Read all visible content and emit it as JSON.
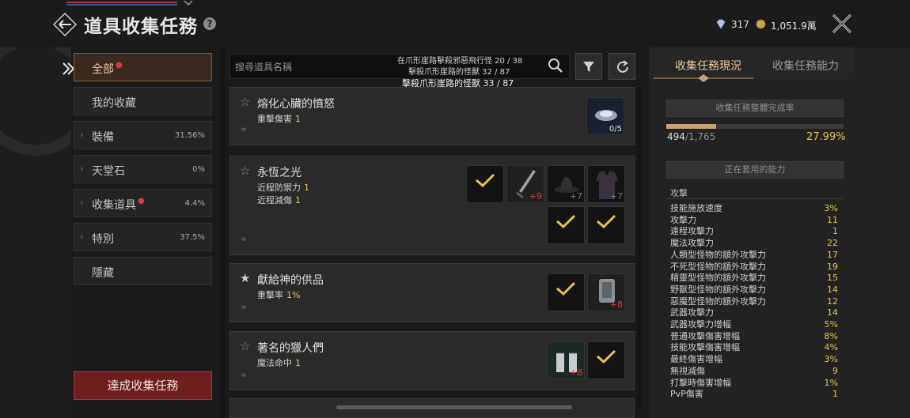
{
  "header": {
    "title": "道具收集任務",
    "help": "?",
    "gem_count": "317",
    "coin_count": "1,051.9萬"
  },
  "sidebar": {
    "categories": [
      {
        "label": "全部",
        "pct": ""
      },
      {
        "label": "我的收藏",
        "pct": ""
      },
      {
        "label": "裝備",
        "pct": "31.56%"
      },
      {
        "label": "天堂石",
        "pct": "0%"
      },
      {
        "label": "收集道具",
        "pct": "4.4%"
      },
      {
        "label": "特別",
        "pct": "37.5%"
      },
      {
        "label": "隱藏",
        "pct": ""
      }
    ],
    "achieve_button": "達成收集任務"
  },
  "search": {
    "placeholder": "搜尋道具名稱",
    "notes": [
      "在爪形崖路擊殺邪惡飛行怪 20 / 38",
      "擊殺爪形崖路的怪獸 32 / 87",
      "擊殺爪形崖路的怪獸 33 / 87"
    ]
  },
  "quests": [
    {
      "title": "熔化心臟的憤怒",
      "stats": [
        {
          "name": "重擊傷害",
          "value": "1"
        }
      ],
      "count": "0/5"
    },
    {
      "title": "永恆之光",
      "stats": [
        {
          "name": "近程防禦力",
          "value": "1"
        },
        {
          "name": "近程減傷",
          "value": "1"
        }
      ],
      "plus": [
        "+9",
        "+7",
        "+7"
      ]
    },
    {
      "title": "獻給神的供品",
      "stats": [
        {
          "name": "重擊率",
          "value": "1%"
        }
      ],
      "plus": [
        "+8"
      ]
    },
    {
      "title": "著名的獵人們",
      "stats": [
        {
          "name": "魔法命中",
          "value": "1"
        }
      ],
      "plus": [
        "+8"
      ]
    }
  ],
  "right_panel": {
    "tabs": [
      "收集任務現況",
      "收集任務能力"
    ],
    "completion_title": "收集任務整體完成率",
    "progress_current": "494",
    "progress_total": "/1,765",
    "progress_pct": "27.99%",
    "progress_fraction": 0.2799,
    "applied_title": "正在套用的能力",
    "section": "攻擊",
    "abilities": [
      {
        "name": "技能施放速度",
        "value": "3%"
      },
      {
        "name": "攻擊力",
        "value": "11"
      },
      {
        "name": "遠程攻擊力",
        "value": "1"
      },
      {
        "name": "魔法攻擊力",
        "value": "22"
      },
      {
        "name": "人類型怪物的額外攻擊力",
        "value": "17"
      },
      {
        "name": "不死型怪物的額外攻擊力",
        "value": "19"
      },
      {
        "name": "精靈型怪物的額外攻擊力",
        "value": "15"
      },
      {
        "name": "野獸型怪物的額外攻擊力",
        "value": "14"
      },
      {
        "name": "惡魔型怪物的額外攻擊力",
        "value": "12"
      },
      {
        "name": "武器攻擊力",
        "value": "14"
      },
      {
        "name": "武器攻擊力增幅",
        "value": "5%"
      },
      {
        "name": "普通攻擊傷害增幅",
        "value": "8%"
      },
      {
        "name": "技能攻擊傷害增幅",
        "value": "4%"
      },
      {
        "name": "最終傷害增幅",
        "value": "3%"
      },
      {
        "name": "無視減傷",
        "value": "9"
      },
      {
        "name": "打擊時傷害增幅",
        "value": "1%"
      },
      {
        "name": "PvP傷害",
        "value": "1"
      }
    ]
  },
  "colors": {
    "accent": "#e8c24a",
    "active": "#e8c9a0",
    "danger": "#d83a3a",
    "button": "#6e1f1d"
  }
}
